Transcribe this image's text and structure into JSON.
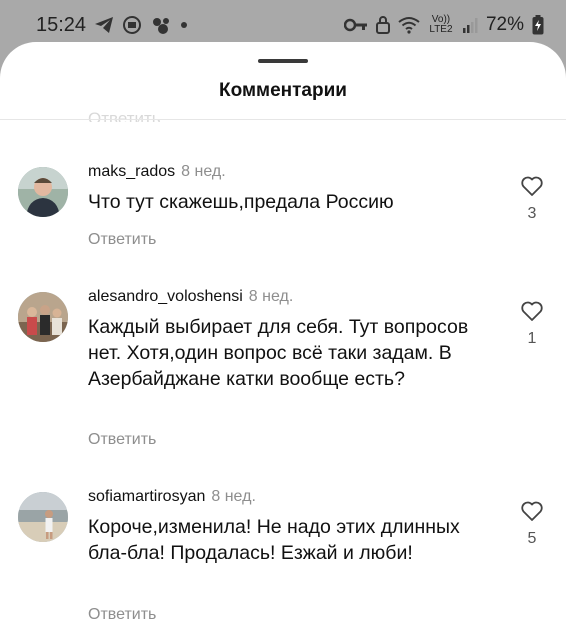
{
  "status_bar": {
    "time": "15:24",
    "battery": "72%",
    "network": "Vo)) LTE2"
  },
  "sheet": {
    "title": "Комментарии",
    "ghost_reply": "Ответить"
  },
  "comments": [
    {
      "username": "maks_rados",
      "time": "8 нед.",
      "text": "Что тут скажешь,предала Россию",
      "reply": "Ответить",
      "likes": "3",
      "avatar": "avatar-photo-young-man"
    },
    {
      "username": "alesandro_voloshensi",
      "time": "8 нед.",
      "text": "Каждый выбирает для себя. Тут вопросов нет. Хотя,один вопрос всё таки задам. В Азербайджане катки вообще есть?",
      "reply": "Ответить",
      "likes": "1",
      "avatar": "avatar-photo-group"
    },
    {
      "username": "sofiamartirosyan",
      "time": "8 нед.",
      "text": "Короче,изменила! Не надо этих длинных бла-бла! Продалась! Езжай и люби!",
      "reply": "Ответить",
      "likes": "5",
      "avatar": "avatar-photo-beach"
    }
  ],
  "colors": {
    "overlay": "#a9a9a9",
    "sheet": "#ffffff",
    "secondary_text": "#8e8e8e"
  }
}
